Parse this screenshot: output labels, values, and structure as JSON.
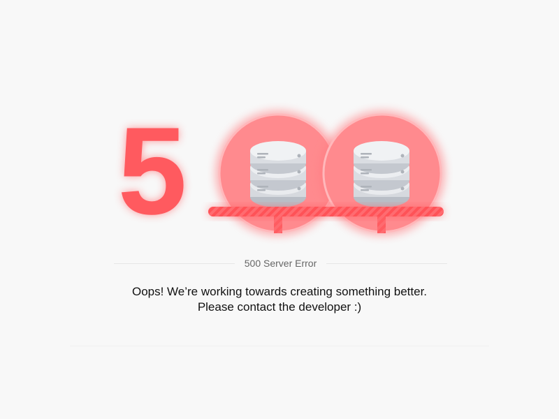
{
  "error": {
    "code_digit": "5",
    "title": "500 Server Error",
    "message_line1": "Oops! We’re working towards creating something better.",
    "message_line2": "Please contact the developer :)"
  },
  "illustration": {
    "icons": [
      "server-database-icon",
      "server-database-icon"
    ]
  },
  "colors": {
    "accent": "#ff5a5f",
    "accent_light": "#ff8a8a",
    "server_body": "#dadde2",
    "background": "#f8f8f8"
  }
}
